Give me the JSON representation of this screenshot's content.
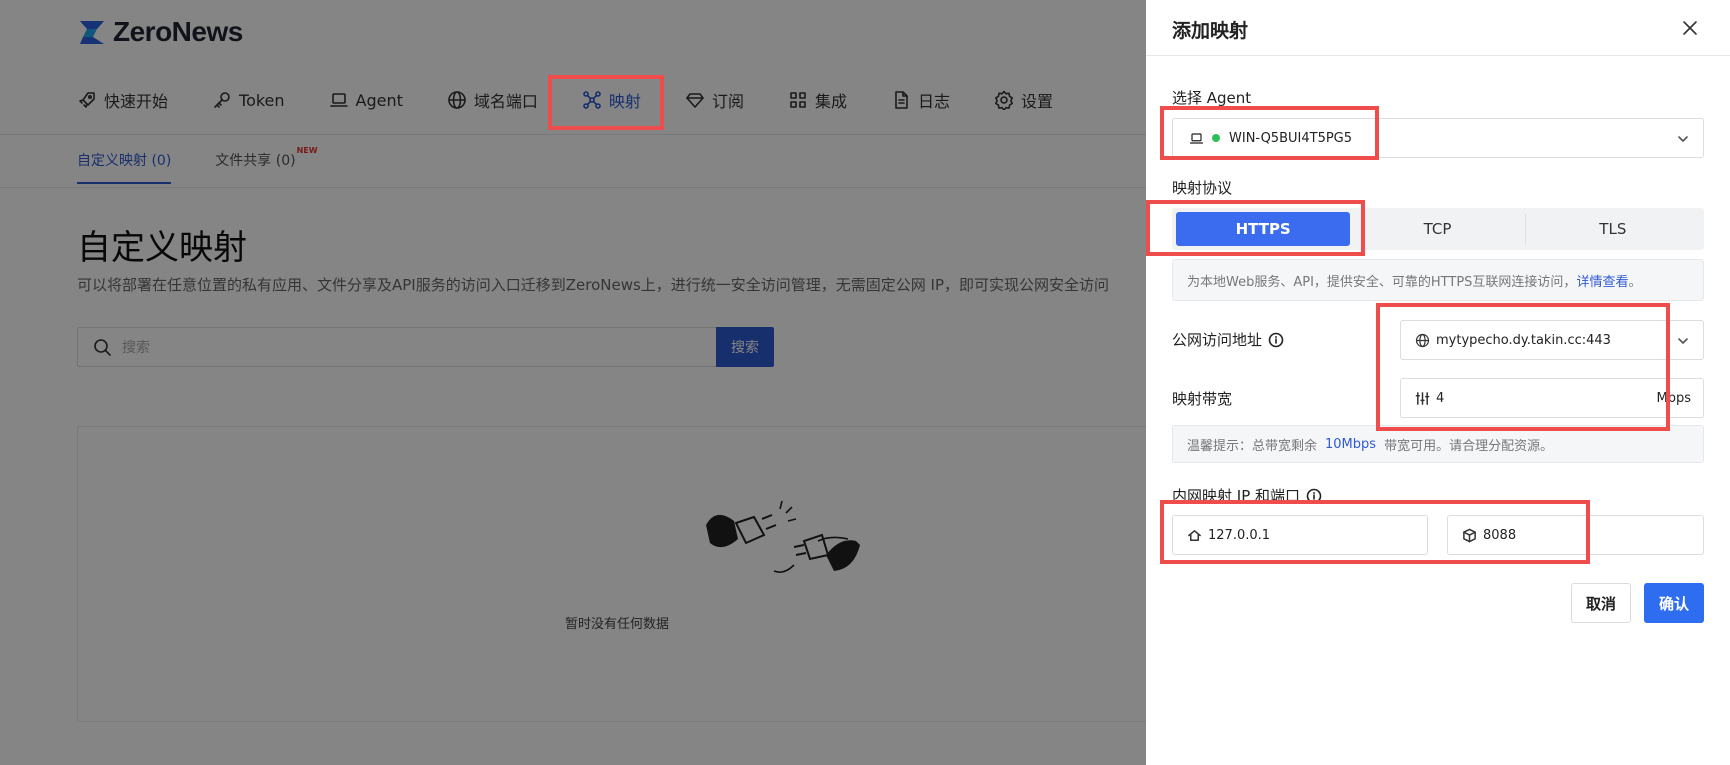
{
  "app": {
    "brand": "ZeroNews"
  },
  "nav": {
    "items": [
      {
        "label": "快速开始",
        "icon": "rocket-icon"
      },
      {
        "label": "Token",
        "icon": "key-icon"
      },
      {
        "label": "Agent",
        "icon": "laptop-icon"
      },
      {
        "label": "域名端口",
        "icon": "globe-icon"
      },
      {
        "label": "映射",
        "icon": "mapping-icon",
        "active": true
      },
      {
        "label": "订阅",
        "icon": "diamond-icon"
      },
      {
        "label": "集成",
        "icon": "grid-icon"
      },
      {
        "label": "日志",
        "icon": "document-icon"
      },
      {
        "label": "设置",
        "icon": "gear-icon"
      }
    ]
  },
  "subtabs": {
    "custom": "自定义映射 (0)",
    "share": "文件共享 (0)",
    "new_badge": "NEW"
  },
  "page": {
    "title": "自定义映射",
    "description": "可以将部署在任意位置的私有应用、文件分享及API服务的访问入口迁移到ZeroNews上，进行统一安全访问管理，无需固定公网 IP，即可实现公网安全访问"
  },
  "search": {
    "placeholder": "搜索",
    "button": "搜索"
  },
  "empty": {
    "text": "暂时没有任何数据"
  },
  "drawer": {
    "title": "添加映射",
    "agent_label": "选择 Agent",
    "agent_value": "WIN-Q5BUI4T5PG5",
    "protocol_label": "映射协议",
    "protocols": [
      "HTTPS",
      "TCP",
      "TLS"
    ],
    "protocol_selected": "HTTPS",
    "protocol_tip": "为本地Web服务、API，提供安全、可靠的HTTPS互联网连接访问，",
    "protocol_tip_link": "详情查看",
    "protocol_tip_end": "。",
    "public_label": "公网访问地址",
    "public_value": "mytypecho.dy.takin.cc:443",
    "bandwidth_label": "映射带宽",
    "bandwidth_value": "4",
    "bandwidth_unit": "Mbps",
    "bandwidth_tip_prefix": "温馨提示：总带宽剩余",
    "bandwidth_tip_value": "10Mbps",
    "bandwidth_tip_suffix": "带宽可用。请合理分配资源。",
    "internal_label": "内网映射 IP 和端口",
    "internal_ip": "127.0.0.1",
    "internal_port": "8088",
    "cancel": "取消",
    "confirm": "确认"
  },
  "colors": {
    "accent": "#2f5bd3",
    "primary_button": "#2f6df0",
    "segment_active": "#3b6cf0",
    "status_online": "#2ec05c",
    "annotation": "#ef4c4c"
  }
}
